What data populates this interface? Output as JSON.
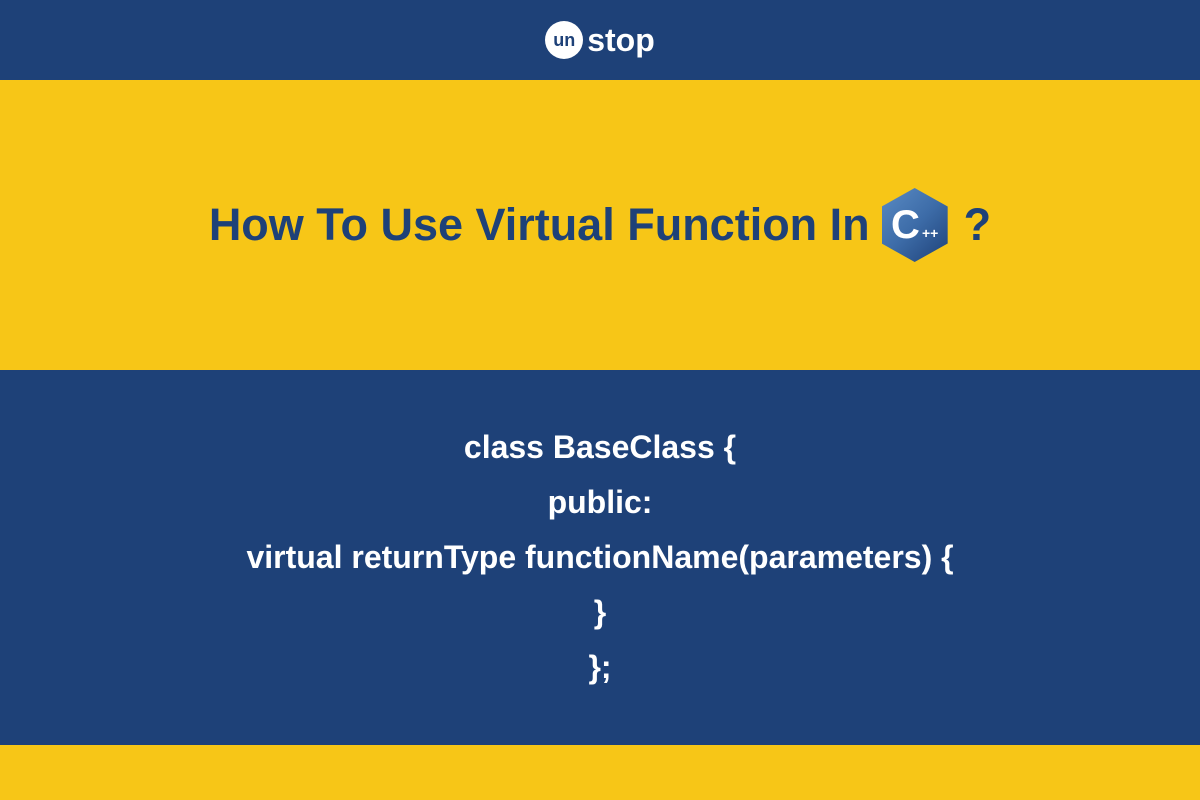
{
  "logo": {
    "circle_text": "un",
    "text": "stop"
  },
  "title": {
    "part1": "How To Use Virtual Function In",
    "cpp_c": "C",
    "cpp_plus": "++",
    "question": "?"
  },
  "code": {
    "line1": "class BaseClass {",
    "line2": "public:",
    "line3": "virtual returnType functionName(parameters) {",
    "line4": "}",
    "line5": "};"
  }
}
